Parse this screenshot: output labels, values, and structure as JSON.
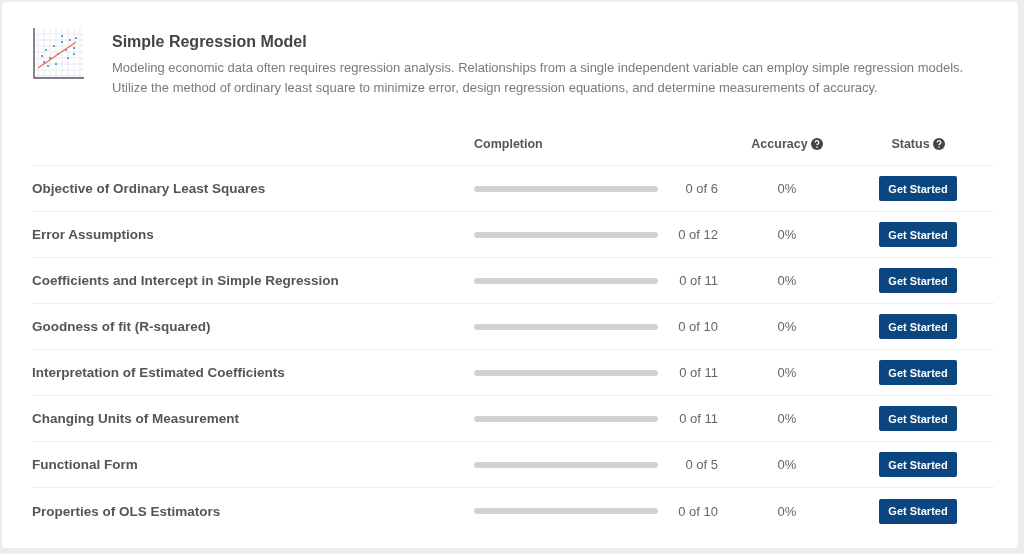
{
  "module": {
    "title": "Simple Regression Model",
    "description": "Modeling economic data often requires regression analysis. Relationships from a single independent variable can employ simple regression models. Utilize the method of ordinary least square to minimize error, design regression equations, and determine measurements of accuracy."
  },
  "table": {
    "columns": [
      {
        "label": "Completion",
        "help": false
      },
      {
        "label": "Accuracy",
        "help": true
      },
      {
        "label": "Status",
        "help": true
      }
    ],
    "rows": [
      {
        "topic": "Objective of Ordinary Least Squares",
        "count": "0 of 6",
        "accuracy": "0%",
        "action": "Get Started"
      },
      {
        "topic": "Error Assumptions",
        "count": "0 of 12",
        "accuracy": "0%",
        "action": "Get Started"
      },
      {
        "topic": "Coefficients and Intercept in Simple Regression",
        "count": "0 of 11",
        "accuracy": "0%",
        "action": "Get Started"
      },
      {
        "topic": "Goodness of fit (R-squared)",
        "count": "0 of 10",
        "accuracy": "0%",
        "action": "Get Started"
      },
      {
        "topic": "Interpretation of Estimated Coefficients",
        "count": "0 of 11",
        "accuracy": "0%",
        "action": "Get Started"
      },
      {
        "topic": "Changing Units of Measurement",
        "count": "0 of 11",
        "accuracy": "0%",
        "action": "Get Started"
      },
      {
        "topic": "Functional Form",
        "count": "0 of 5",
        "accuracy": "0%",
        "action": "Get Started"
      },
      {
        "topic": "Properties of OLS Estimators",
        "count": "0 of 10",
        "accuracy": "0%",
        "action": "Get Started"
      }
    ]
  }
}
